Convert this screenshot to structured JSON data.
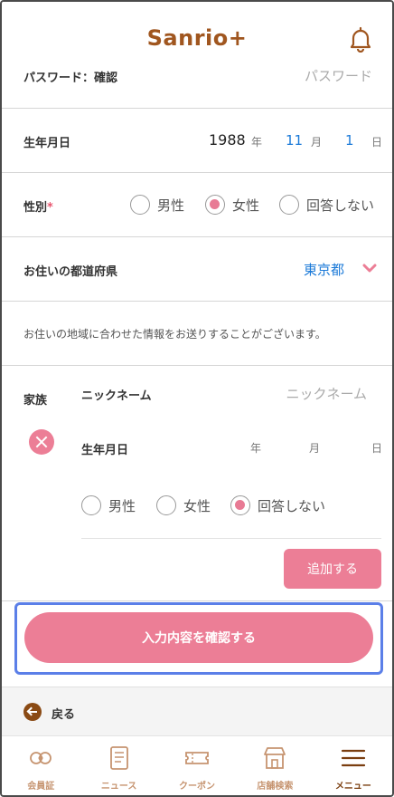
{
  "header": {
    "logo": "Sanrio+",
    "bell_icon": "bell-icon"
  },
  "password_confirm": {
    "label": "パスワード：確認",
    "placeholder": "パスワード"
  },
  "birthdate": {
    "label": "生年月日",
    "year": "1988",
    "year_unit": "年",
    "month": "11",
    "month_unit": "月",
    "day": "1",
    "day_unit": "日"
  },
  "gender": {
    "label": "性別",
    "required_mark": "*",
    "options": [
      "男性",
      "女性",
      "回答しない"
    ],
    "selected": "女性"
  },
  "prefecture": {
    "label": "お住いの都道府県",
    "value": "東京都"
  },
  "note": "お住いの地域に合わせた情報をお送りすることがございます。",
  "family": {
    "label": "家族",
    "nickname_label": "ニックネーム",
    "nickname_placeholder": "ニックネーム",
    "birthdate_label": "生年月日",
    "year_unit": "年",
    "month_unit": "月",
    "day_unit": "日",
    "gender_options": [
      "男性",
      "女性",
      "回答しない"
    ],
    "gender_selected": "回答しない",
    "add_button": "追加する"
  },
  "confirm_button": "入力内容を確認する",
  "back_label": "戻る",
  "tabs": [
    {
      "label": "会員証",
      "icon": "member-card-icon"
    },
    {
      "label": "ニュース",
      "icon": "news-icon"
    },
    {
      "label": "クーポン",
      "icon": "coupon-icon"
    },
    {
      "label": "店舗検索",
      "icon": "store-icon"
    },
    {
      "label": "メニュー",
      "icon": "menu-icon"
    }
  ],
  "colors": {
    "accent_pink": "#ec7e96",
    "brand_brown": "#a0561f",
    "link_blue": "#1b7ad8",
    "focus_blue": "#5b7fe8"
  }
}
